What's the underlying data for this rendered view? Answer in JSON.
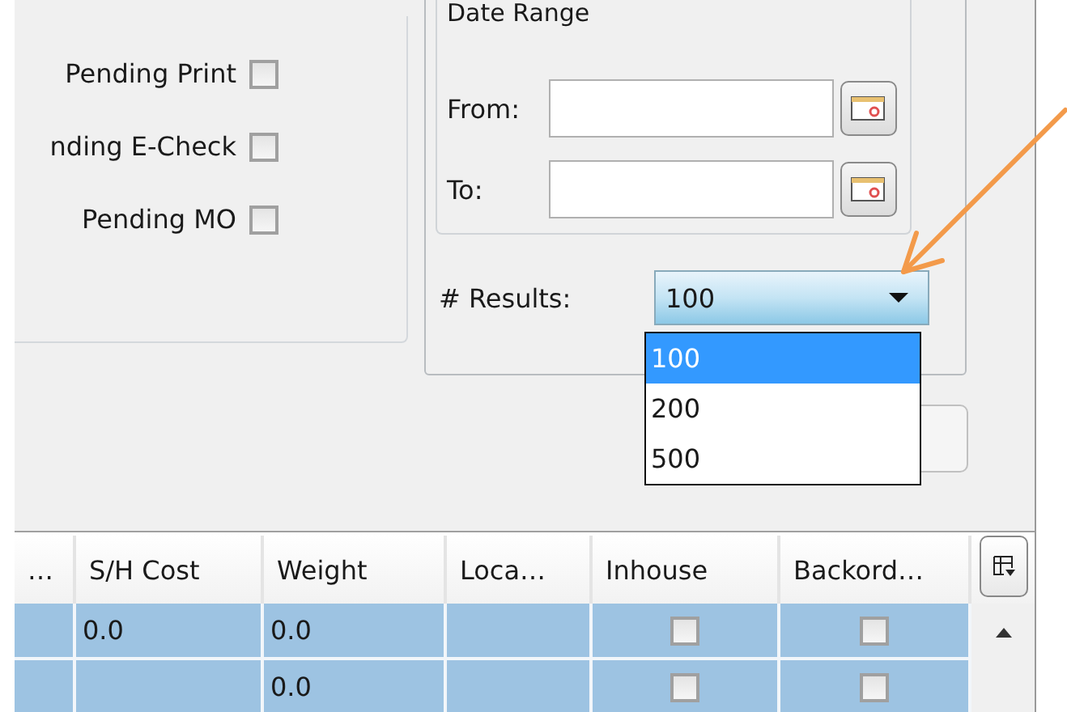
{
  "filters": [
    {
      "label": "Pending Print",
      "checked": false
    },
    {
      "label": "nding E-Check",
      "checked": false
    },
    {
      "label": "Pending MO",
      "checked": false
    }
  ],
  "date_range": {
    "title": "Date Range",
    "fields": [
      {
        "label": "From:"
      },
      {
        "label": "To:"
      }
    ]
  },
  "results": {
    "label": "# Results:",
    "value": "100",
    "options": [
      {
        "label": "100",
        "selected": true
      },
      {
        "label": "200",
        "selected": false
      },
      {
        "label": "500",
        "selected": false
      }
    ]
  },
  "table": {
    "columns": [
      "…",
      "S/H Cost",
      "Weight",
      "Loca…",
      "Inhouse",
      "Backord…"
    ],
    "rows": [
      {
        "sh_cost": "0.0",
        "weight": "0.0",
        "inhouse": false,
        "backorder": false,
        "selected": true
      },
      {
        "weight": "0.0",
        "inhouse": false,
        "backorder": false,
        "selected": true
      }
    ]
  }
}
